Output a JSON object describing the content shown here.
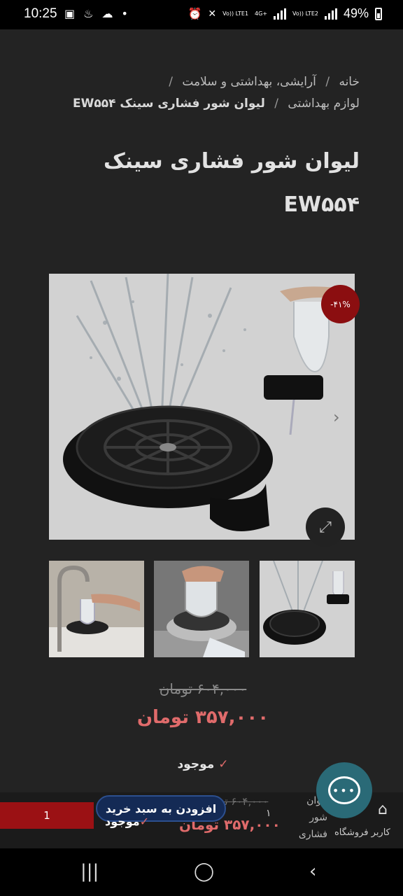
{
  "status_bar": {
    "time": "10:25",
    "battery": "49%",
    "sim1_label": "Vo)) LTE1",
    "sim2_label": "Vo)) LTE2",
    "net_label": "4G+"
  },
  "breadcrumb": {
    "items": [
      "خانه",
      "آرایشی، بهداشتی و سلامت",
      "لوازم بهداشتی"
    ],
    "current": "لیوان شور فشاری سینک EW۵۵۴",
    "separator": "/"
  },
  "product": {
    "title": "لیوان شور فشاری سینک EW۵۵۴",
    "sale_badge": "-۴۱%",
    "price_old": "۶۰۴,۰۰۰ تومان",
    "price_new": "۳۵۷,۰۰۰ تومان",
    "stock": "موجود"
  },
  "sticky_bar": {
    "quantity": "1",
    "qty_number": "۱",
    "cart_button": "افزودن به سبد خرید",
    "stock": "موجود",
    "price_old": "۶۰۴,۰۰۰ تومان",
    "price_new": "۳۵۷,۰۰۰ تومان",
    "product_name": "لیوان شور فشاری",
    "nav_label": "کاربر فروشگاه"
  },
  "colors": {
    "background": "#232323",
    "accent_red": "#9b1114",
    "price_red": "#e06b6b",
    "cart_blue": "#142a55",
    "chat_teal": "#2a6a77"
  },
  "icons": [
    "alarm-icon",
    "wifi-icon",
    "signal-icon",
    "battery-icon",
    "zoom-icon",
    "chevron-right-icon",
    "check-icon",
    "chat-icon",
    "store-icon",
    "back-icon",
    "home-icon",
    "recents-icon"
  ]
}
